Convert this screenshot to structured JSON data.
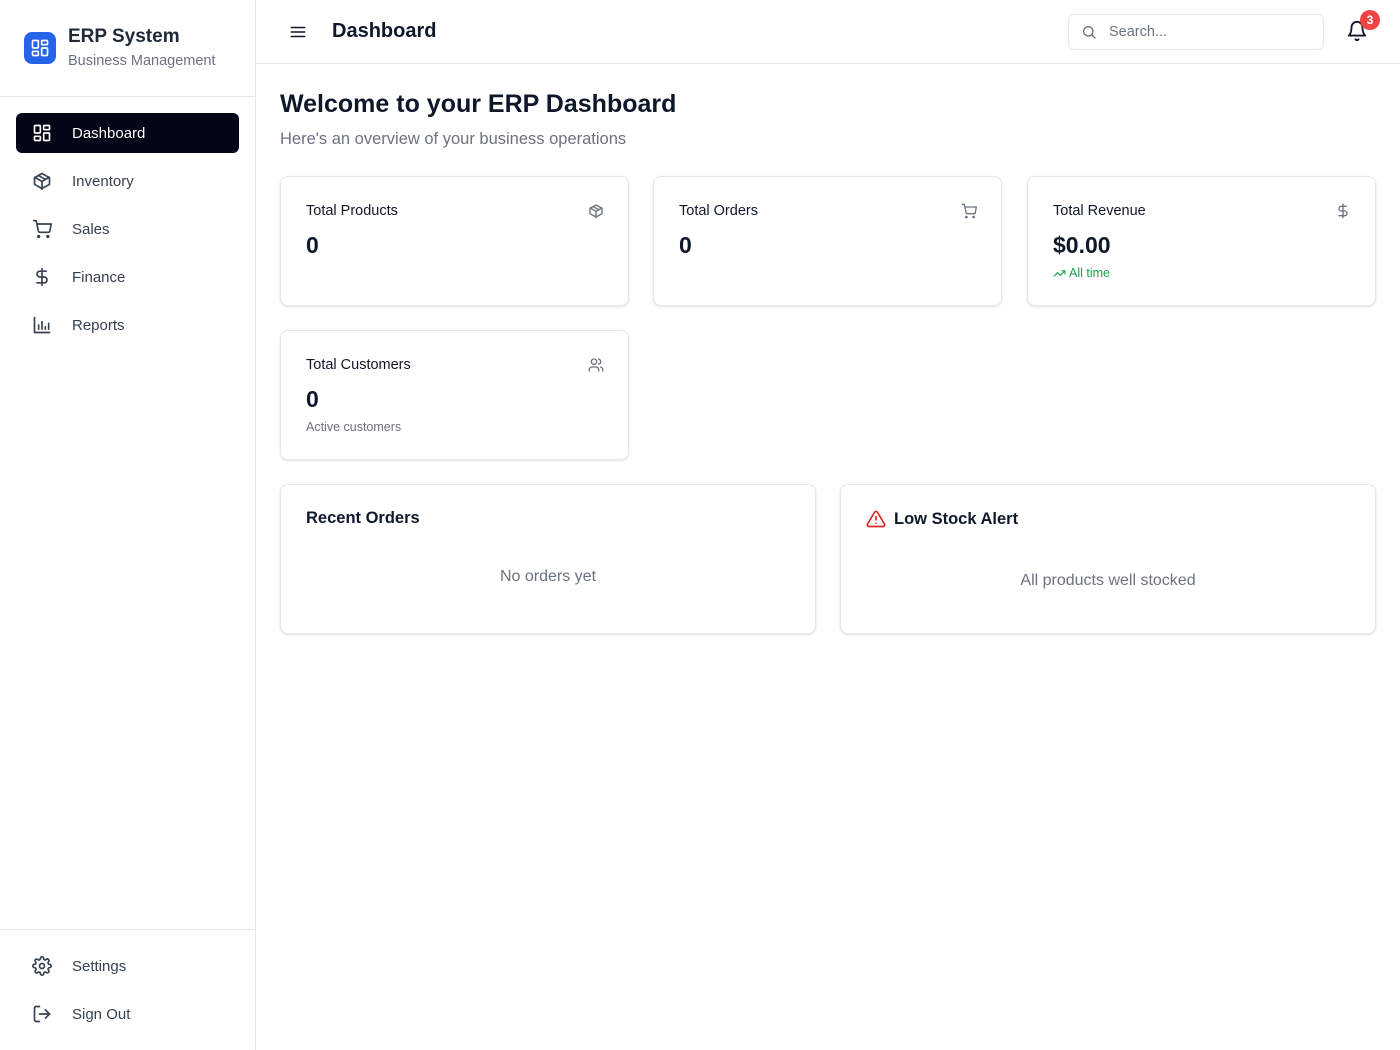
{
  "brand": {
    "title": "ERP System",
    "subtitle": "Business Management",
    "logo_icon": "grid-icon",
    "accent": "#2563eb"
  },
  "sidebar": {
    "items": [
      {
        "label": "Dashboard",
        "icon": "layout-dashboard-icon",
        "active": true
      },
      {
        "label": "Inventory",
        "icon": "package-icon",
        "active": false
      },
      {
        "label": "Sales",
        "icon": "shopping-cart-icon",
        "active": false
      },
      {
        "label": "Finance",
        "icon": "dollar-sign-icon",
        "active": false
      },
      {
        "label": "Reports",
        "icon": "bar-chart-icon",
        "active": false
      }
    ],
    "bottom": [
      {
        "label": "Settings",
        "icon": "gear-icon"
      },
      {
        "label": "Sign Out",
        "icon": "log-out-icon"
      }
    ]
  },
  "header": {
    "title": "Dashboard",
    "search_placeholder": "Search...",
    "notification_count": "3"
  },
  "main": {
    "welcome_title": "Welcome to your ERP Dashboard",
    "welcome_subtitle": "Here's an overview of your business operations",
    "stats": [
      {
        "title": "Total Products",
        "value": "0",
        "icon": "package-icon",
        "footnote": ""
      },
      {
        "title": "Total Orders",
        "value": "0",
        "icon": "shopping-cart-icon",
        "footnote": ""
      },
      {
        "title": "Total Revenue",
        "value": "$0.00",
        "icon": "dollar-sign-icon",
        "footnote": "All time"
      },
      {
        "title": "Total Customers",
        "value": "0",
        "icon": "users-icon",
        "footnote": "Active customers"
      }
    ],
    "recent_orders": {
      "title": "Recent Orders",
      "empty": "No orders yet"
    },
    "low_stock": {
      "title": "Low Stock Alert",
      "empty": "All products well stocked",
      "alert_color": "#dc2626"
    }
  },
  "colors": {
    "active_nav_bg": "#020617",
    "success": "#16a34a",
    "badge": "#ef4444"
  }
}
